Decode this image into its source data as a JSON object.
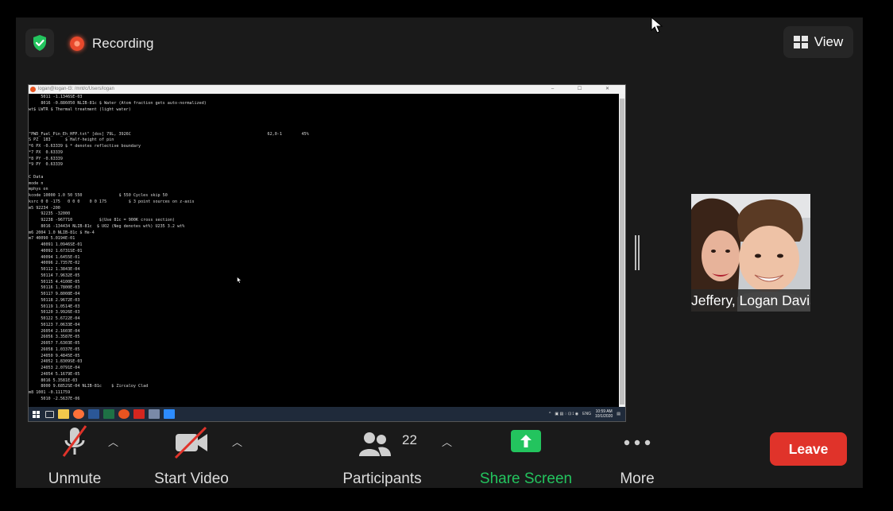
{
  "header": {
    "recording_label": "Recording",
    "view_label": "View"
  },
  "shared_screen": {
    "window_title": "logan@logan-t3: /mnt/c/Users/logan",
    "window_controls": "– ☐ ✕",
    "terminal_lines": [
      "     5011 -1.1346SE-03",
      "     8016 -0.886050 NLIB-81c $ Water (Atom fraction gets auto-normalized)",
      "wt$ LWTR $ Thermal treatment (light water)",
      "",
      "",
      "",
      "\"PWD_Fuel_Pin_Eh_HFP.txt\" [dos] 79L, 3926C                                                        62,0-1        45%",
      "S PZ  183      $ Half-height of pin",
      "*6 PX -0.63339 $ * denotes reflective boundary",
      "*7 PX  0.63339",
      "*8 PY -0.63339",
      "*9 PY  0.63339",
      "",
      "C Data",
      "mode n",
      "mphys on",
      "kcode 10000 1.0 50 550               $ 550 Cycles skip 50",
      "ksrc 0 0 -175   0 0 0    0 0 175         $ 3 point sources on z-axis",
      "m5 92234 -200",
      "     92235 -32000",
      "     92238 -967710           $(Use 81c = 900K cross section)",
      "     8016 -134434 NLIB-81c  $ UO2 (Neg denotes wt%) U235 3.2 wt%",
      "m6 2004 1.0 NLIB-81c $ He-4",
      "m7 40090 5.0194E-01",
      "     40091 1.0946SE-01",
      "     40092 1.6731SE-01",
      "     40094 1.6455E-01",
      "     40096 2.7357E-02",
      "     50112 1.3843E-04",
      "     50114 7.9632E-05",
      "     50115 4.4100E-05",
      "     50116 1.7800E-03",
      "     50117 9.8008E-04",
      "     50118 2.9672E-03",
      "     50119 1.0514E-03",
      "     50120 3.9926E-03",
      "     50122 5.6722E-04",
      "     50123 7.0633E-04",
      "     26054 2.1603E-04",
      "     26056 3.3587E-05",
      "     26057 7.6303E-05",
      "     26058 1.0337E-05",
      "     24050 9.4845E-05",
      "     24052 1.8309SE-03",
      "     24053 2.0791E-04",
      "     24054 5.1679E-05",
      "     8016 5.3581E-03",
      "     8000 9.6852SE-04 NLIB-81c    $ Zircaloy Clad",
      "m8 1001 -0.111759",
      "     5010 -2.5637E-06"
    ],
    "tray_lang": "ENG",
    "clock_time": "10:59 AM",
    "clock_date": "10/1/2020"
  },
  "participant": {
    "name": "Jeffery, Logan Davis"
  },
  "toolbar": {
    "unmute_label": "Unmute",
    "start_video_label": "Start Video",
    "participants_label": "Participants",
    "participants_count": "22",
    "share_screen_label": "Share Screen",
    "more_label": "More",
    "leave_label": "Leave"
  },
  "colors": {
    "accent_green": "#23c45e",
    "leave_red": "#e0332a",
    "recording_red": "#e8492c"
  }
}
